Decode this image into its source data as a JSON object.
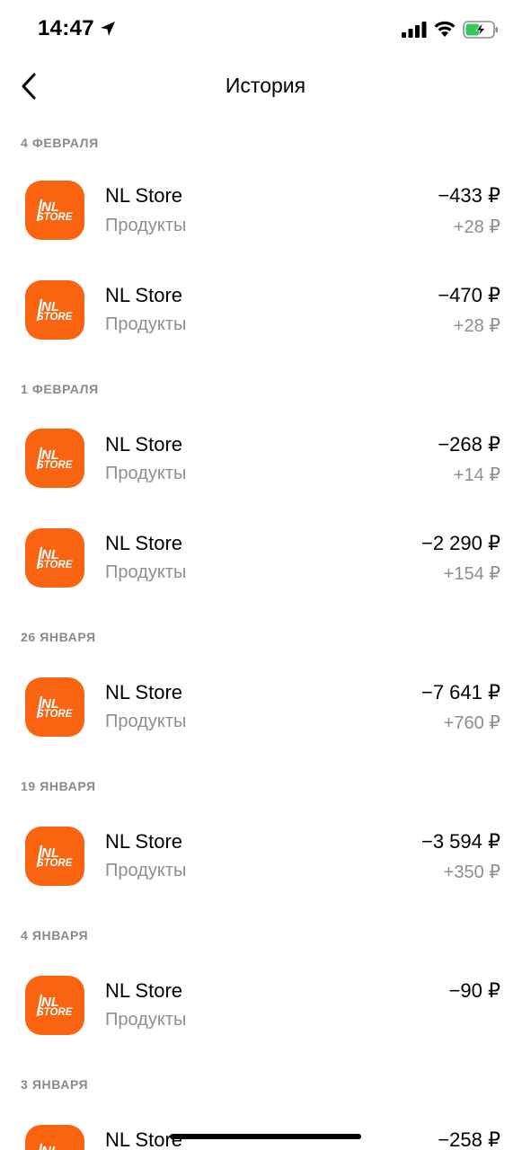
{
  "status_bar": {
    "time": "14:47"
  },
  "nav": {
    "title": "История"
  },
  "logo": {
    "line1": "NL",
    "line2": "STORE",
    "color": "#fa6411"
  },
  "sections": [
    {
      "date": "4 февраля"
    },
    {
      "date": "1 февраля"
    },
    {
      "date": "26 января"
    },
    {
      "date": "19 января"
    },
    {
      "date": "4 января"
    },
    {
      "date": "3 января"
    }
  ],
  "transactions": [
    {
      "merchant": "NL Store",
      "category": "Продукты",
      "amount": "−433 ₽",
      "cashback": "+28 ₽"
    },
    {
      "merchant": "NL Store",
      "category": "Продукты",
      "amount": "−470 ₽",
      "cashback": "+28 ₽"
    },
    {
      "merchant": "NL Store",
      "category": "Продукты",
      "amount": "−268 ₽",
      "cashback": "+14 ₽"
    },
    {
      "merchant": "NL Store",
      "category": "Продукты",
      "amount": "−2 290 ₽",
      "cashback": "+154 ₽"
    },
    {
      "merchant": "NL Store",
      "category": "Продукты",
      "amount": "−7 641 ₽",
      "cashback": "+760 ₽"
    },
    {
      "merchant": "NL Store",
      "category": "Продукты",
      "amount": "−3 594 ₽",
      "cashback": "+350 ₽"
    },
    {
      "merchant": "NL Store",
      "category": "Продукты",
      "amount": "−90 ₽",
      "cashback": ""
    },
    {
      "merchant": "NL Store",
      "category": "",
      "amount": "−258 ₽",
      "cashback": ""
    }
  ]
}
